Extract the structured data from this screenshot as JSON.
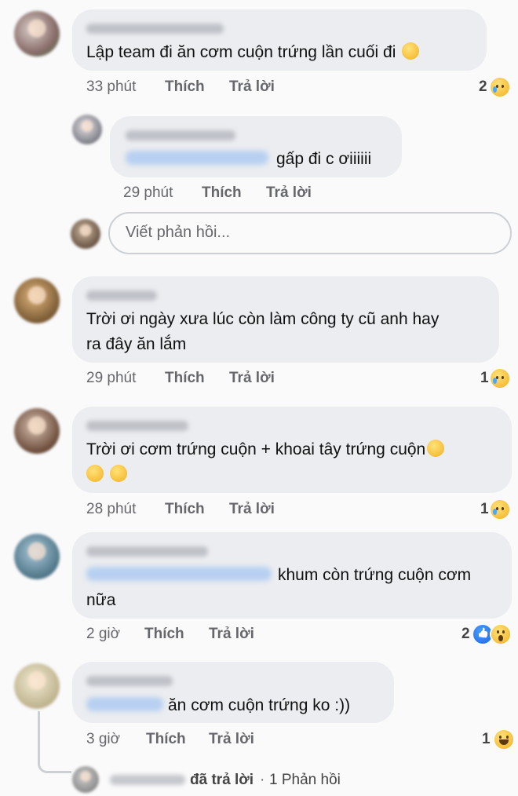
{
  "comments": [
    {
      "text": "Lập team đi ăn cơm cuộn trứng lần cuối đi",
      "emoji": "weary-face",
      "time": "33 phút",
      "like": "Thích",
      "reply": "Trả lời",
      "reactions": "2",
      "reaction_icons": [
        "sad-face"
      ]
    },
    {
      "text": "gấp đi c ơiiiiii",
      "time": "29 phút",
      "like": "Thích",
      "reply": "Trả lời"
    },
    {
      "text_line1": "Trời ơi ngày xưa lúc còn làm công ty cũ anh hay",
      "text_line2": "ra đây ăn lắm",
      "time": "29 phút",
      "like": "Thích",
      "reply": "Trả lời",
      "reactions": "1",
      "reaction_icons": [
        "sad-face"
      ]
    },
    {
      "text_line1": "Trời ơi cơm trứng cuộn + khoai tây trứng cuộn",
      "emoji": [
        "sad-face",
        "sad-face",
        "sad-face"
      ],
      "time": "28 phút",
      "like": "Thích",
      "reply": "Trả lời",
      "reactions": "1",
      "reaction_icons": [
        "sad-face"
      ]
    },
    {
      "text_line1": "khum còn trứng cuộn cơm",
      "text_line2": "nữa",
      "time": "2 giờ",
      "like": "Thích",
      "reply": "Trả lời",
      "reactions": "2",
      "reaction_icons": [
        "like-icon",
        "wow-face"
      ]
    },
    {
      "text": "ăn cơm cuộn trứng ko :))",
      "time": "3 giờ",
      "like": "Thích",
      "reply": "Trả lời",
      "reactions": "1",
      "reaction_icons": [
        "haha-face"
      ]
    }
  ],
  "reply_box": {
    "placeholder": "Viết phản hồi..."
  },
  "replied_summary": {
    "action": "đã trả lời",
    "separator": "·",
    "count_label": "1 Phản hồi"
  },
  "colors": {
    "bubble": "#ebedf0",
    "meta": "#65676b",
    "background": "#fafafb"
  }
}
